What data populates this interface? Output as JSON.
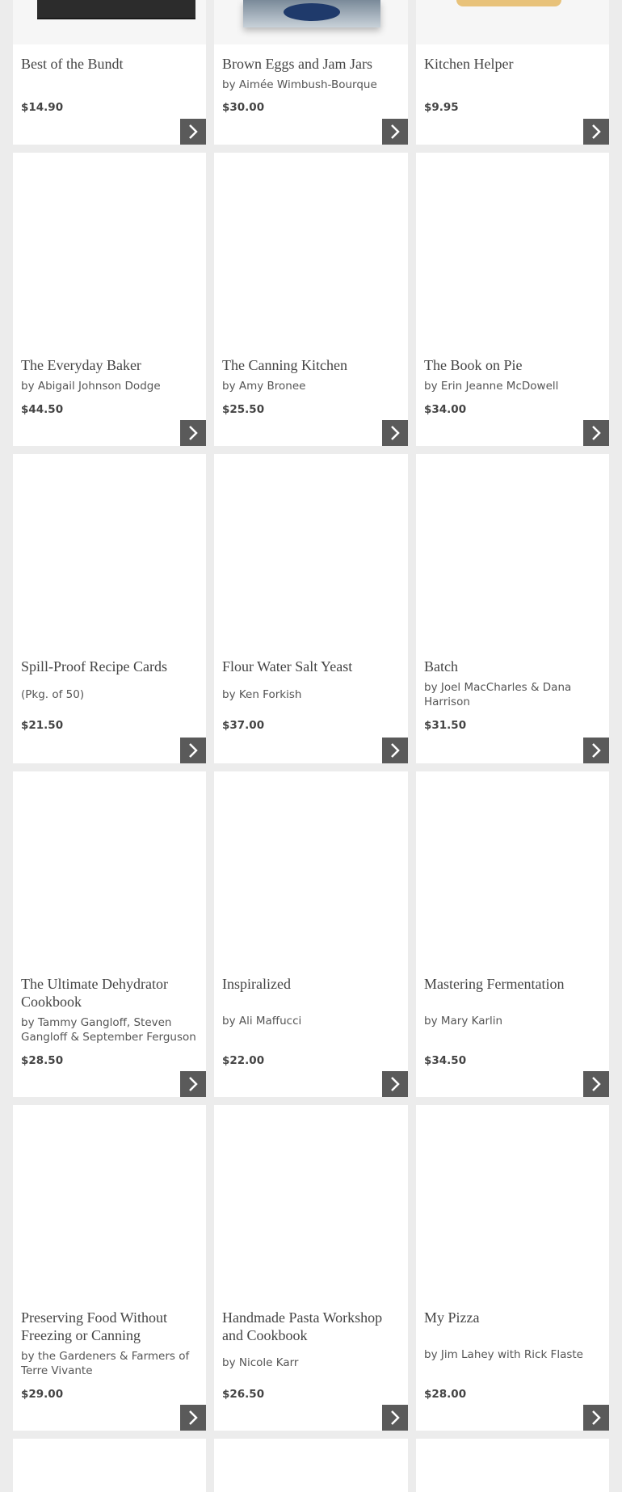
{
  "products": [
    {
      "title": "Best of the Bundt",
      "author": "",
      "price": "$14.90"
    },
    {
      "title": "Brown Eggs and Jam Jars",
      "author": "by Aimée Wimbush-Bourque",
      "price": "$30.00"
    },
    {
      "title": "Kitchen Helper",
      "author": "",
      "price": "$9.95"
    },
    {
      "title": "The Everyday Baker",
      "author": "by Abigail Johnson Dodge",
      "price": "$44.50"
    },
    {
      "title": "The Canning Kitchen",
      "author": "by Amy Bronee",
      "price": "$25.50"
    },
    {
      "title": "The Book on Pie",
      "author": "by Erin Jeanne McDowell",
      "price": "$34.00"
    },
    {
      "title": "Spill-Proof Recipe Cards",
      "author": "(Pkg. of 50)",
      "price": "$21.50"
    },
    {
      "title": "Flour Water Salt Yeast",
      "author": "by Ken Forkish",
      "price": "$37.00"
    },
    {
      "title": "Batch",
      "author": "by Joel MacCharles & Dana Harrison",
      "price": "$31.50"
    },
    {
      "title": "The Ultimate Dehydrator Cookbook",
      "author": "by Tammy Gangloff, Steven Gangloff & September Ferguson",
      "price": "$28.50"
    },
    {
      "title": "Inspiralized",
      "author": "by Ali Maffucci",
      "price": "$22.00"
    },
    {
      "title": "Mastering Fermentation",
      "author": "by Mary Karlin",
      "price": "$34.50"
    },
    {
      "title": "Preserving Food Without Freezing or Canning",
      "author": "by the Gardeners & Farmers of Terre Vivante",
      "price": "$29.00"
    },
    {
      "title": "Handmade Pasta Workshop and Cookbook",
      "author": "by Nicole Karr",
      "price": "$26.50"
    },
    {
      "title": "My Pizza",
      "author": "by Jim Lahey with Rick Flaste",
      "price": "$28.00"
    }
  ],
  "icons": {
    "arrow": "chevron-right-icon"
  },
  "colors": {
    "button": "#5a5a5a",
    "page_bg": "#ececec",
    "card_bg": "#ffffff"
  }
}
